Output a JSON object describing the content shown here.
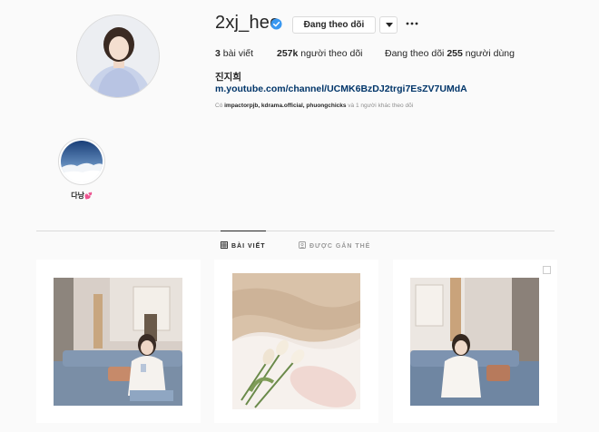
{
  "profile": {
    "username": "2xj_hee",
    "follow_button": "Đang theo dõi",
    "stats": {
      "posts_count": "3",
      "posts_label": " bài viết",
      "followers_count": "257k",
      "followers_label": " người theo dõi",
      "following_prefix": "Đang theo dõi ",
      "following_count": "255",
      "following_label": " người dùng"
    },
    "full_name": "진지희",
    "website": "m.youtube.com/channel/UCMK6BzDJ2trgi7EsZV7UMdA",
    "followed_by": {
      "prefix": "Có ",
      "users": "impactorpjb, kdrama.official, phuongchicks",
      "suffix": " và 1 người khác theo dõi"
    }
  },
  "highlight": {
    "label": "다낭",
    "emoji": "💕"
  },
  "tabs": [
    {
      "label": "BÀI VIẾT",
      "active": true,
      "icon": "grid-icon"
    },
    {
      "label": "ĐƯỢC GẮN THẺ",
      "active": false,
      "icon": "tag-icon"
    }
  ],
  "posts": [
    {
      "name": "post-girl-on-sofa-phone",
      "icon": null
    },
    {
      "name": "post-tulips-fabric",
      "icon": null
    },
    {
      "name": "post-girl-on-sofa-smiling",
      "icon": "multiple-photos-icon"
    }
  ],
  "colors": {
    "verified_blue": "#3897f0",
    "link_color": "#003569",
    "muted_text": "#8e8e8e",
    "border": "#dbdbdb"
  }
}
